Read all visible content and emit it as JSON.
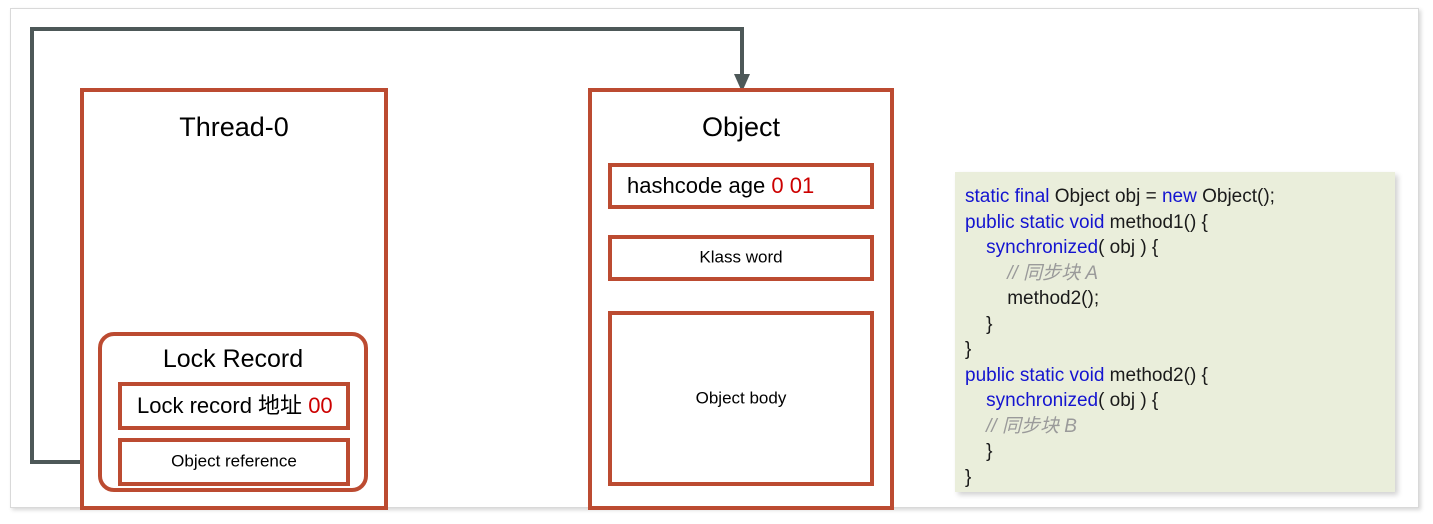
{
  "diagram": {
    "title_thread": "Thread-0",
    "title_object": "Object",
    "title_lock_record": "Lock Record",
    "lock_record_addr_label": "Lock record 地址",
    "lock_record_addr_value": "00",
    "object_reference_label": "Object reference",
    "hashcode_label": "hashcode age",
    "hashcode_value": "0 01",
    "klass_word_label": "Klass word",
    "object_body_label": "Object body",
    "arrow_name": "object-reference-arrow",
    "colors": {
      "box_border": "#BC4B31",
      "connector": "#4D5858",
      "highlight_red": "#CC0000",
      "keyword_blue": "#1414D0",
      "comment_gray": "#9A9A9A",
      "code_background": "#EAEEDB"
    }
  },
  "code": {
    "lines": [
      {
        "indent": 0,
        "tokens": [
          {
            "t": "kw",
            "s": "static final"
          },
          {
            "t": "n",
            "s": " Object obj = "
          },
          {
            "t": "kw",
            "s": "new"
          },
          {
            "t": "n",
            "s": " Object();"
          }
        ]
      },
      {
        "indent": 0,
        "tokens": [
          {
            "t": "kw",
            "s": "public static void"
          },
          {
            "t": "n",
            "s": " method1() {"
          }
        ]
      },
      {
        "indent": 1,
        "tokens": [
          {
            "t": "kw",
            "s": "synchronized"
          },
          {
            "t": "n",
            "s": "( obj ) {"
          }
        ]
      },
      {
        "indent": 2,
        "tokens": [
          {
            "t": "cmt",
            "s": "// 同步块 A"
          }
        ]
      },
      {
        "indent": 2,
        "tokens": [
          {
            "t": "n",
            "s": "method2();"
          }
        ]
      },
      {
        "indent": 1,
        "tokens": [
          {
            "t": "n",
            "s": "}"
          }
        ]
      },
      {
        "indent": 0,
        "tokens": [
          {
            "t": "n",
            "s": "}"
          }
        ]
      },
      {
        "indent": 0,
        "tokens": [
          {
            "t": "kw",
            "s": "public static void"
          },
          {
            "t": "n",
            "s": " method2() {"
          }
        ]
      },
      {
        "indent": 1,
        "tokens": [
          {
            "t": "kw",
            "s": "synchronized"
          },
          {
            "t": "n",
            "s": "( obj ) {"
          }
        ]
      },
      {
        "indent": 1,
        "tokens": [
          {
            "t": "cmt",
            "s": "// 同步块 B"
          }
        ]
      },
      {
        "indent": 1,
        "tokens": [
          {
            "t": "n",
            "s": "}"
          }
        ]
      },
      {
        "indent": 0,
        "tokens": [
          {
            "t": "n",
            "s": "}"
          }
        ]
      }
    ]
  }
}
